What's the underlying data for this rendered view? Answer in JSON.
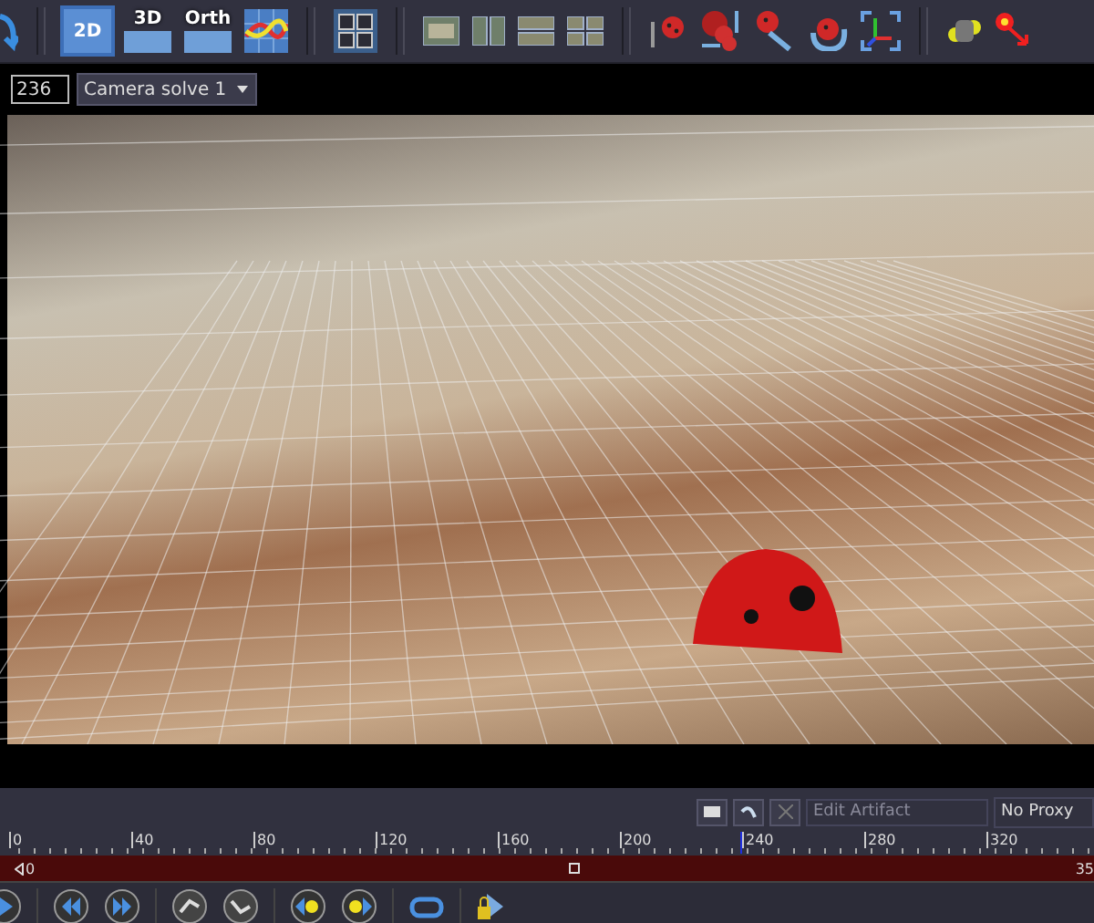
{
  "toolbar": {
    "view_buttons": [
      {
        "label": "2D",
        "selected": true
      },
      {
        "label": "3D",
        "selected": false
      },
      {
        "label": "Orth",
        "selected": false
      }
    ]
  },
  "view_bar": {
    "frame_field": {
      "value": "236"
    },
    "camera_dropdown": {
      "value": "Camera solve 1"
    }
  },
  "control_bar": {
    "edit_field": {
      "placeholder": "Edit Artifact"
    },
    "proxy_dropdown": {
      "value": "No Proxy"
    }
  },
  "timeline": {
    "ticks": [
      "0",
      "40",
      "80",
      "120",
      "160",
      "200",
      "240",
      "280",
      "320"
    ],
    "start_label": "0",
    "end_label": "35",
    "playhead": {
      "level": 0.674
    },
    "marker": {
      "level": 0.516
    }
  }
}
